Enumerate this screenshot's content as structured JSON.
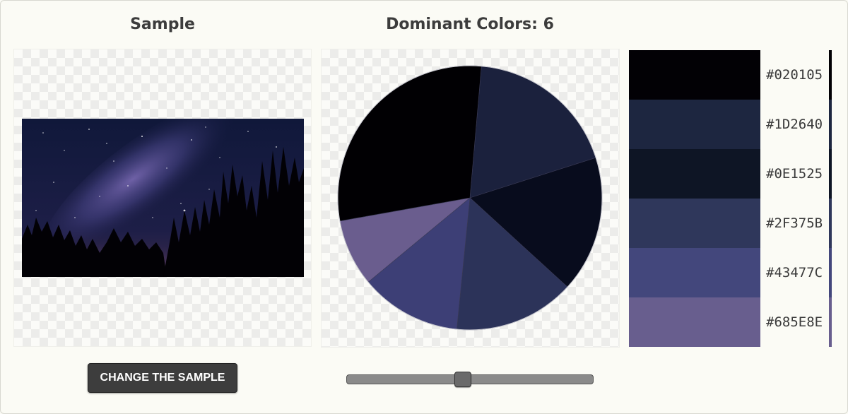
{
  "sample": {
    "heading": "Sample",
    "button_label": "CHANGE THE SAMPLE"
  },
  "dominant": {
    "heading": "Dominant Colors: 6",
    "count": 6
  },
  "slider": {
    "value_fraction": 0.5
  },
  "colors": [
    {
      "hex": "#020105",
      "label": "#020105"
    },
    {
      "hex": "#1D2640",
      "label": "#1D2640"
    },
    {
      "hex": "#0E1525",
      "label": "#0E1525"
    },
    {
      "hex": "#2F375B",
      "label": "#2F375B"
    },
    {
      "hex": "#43477C",
      "label": "#43477C"
    },
    {
      "hex": "#685E8E",
      "label": "#685E8E"
    }
  ],
  "chart_data": {
    "type": "pie",
    "slices": [
      {
        "color": "#1D2640",
        "value": 0.187
      },
      {
        "color": "#0E1525",
        "value": 0.167
      },
      {
        "color": "#2F375B",
        "value": 0.148
      },
      {
        "color": "#43477C",
        "value": 0.124
      },
      {
        "color": "#685E8E",
        "value": 0.082
      },
      {
        "color": "#020105",
        "value": 0.292
      }
    ],
    "pie_colors": [
      "#1b213d",
      "#080c1d",
      "#2c3359",
      "#3d3f76",
      "#6a5d8e",
      "#010003"
    ]
  }
}
